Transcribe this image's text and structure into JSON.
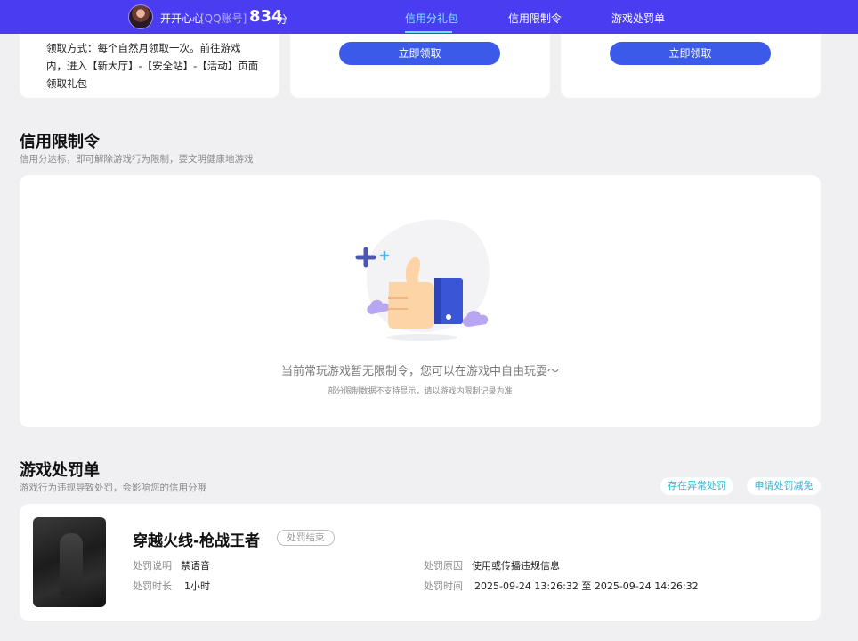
{
  "header": {
    "username": "开开心心",
    "account_type": "[QQ账号]",
    "score": "834",
    "score_unit": "分",
    "tabs": [
      {
        "label": "信用分礼包",
        "active": true
      },
      {
        "label": "信用限制令",
        "active": false
      },
      {
        "label": "游戏处罚单",
        "active": false
      }
    ]
  },
  "gift_section": {
    "claim_method": "领取方式：每个自然月领取一次。前往游戏内，进入【新大厅】-【安全站】-【活动】页面领取礼包",
    "claim_buttons": [
      "立即领取",
      "立即领取"
    ]
  },
  "restriction_section": {
    "title": "信用限制令",
    "subtitle": "信用分达标，即可解除游戏行为限制，要文明健康地游戏",
    "empty_message": "当前常玩游戏暂无限制令，您可以在游戏中自由玩耍～",
    "empty_note": "部分限制数据不支持显示，请以游戏内限制记录为准"
  },
  "penalty_section": {
    "title": "游戏处罚单",
    "subtitle": "游戏行为违规导致处罚，会影响您的信用分哦",
    "actions": [
      "存在异常处罚",
      "申请处罚减免"
    ],
    "record": {
      "game": "穿越火线-枪战王者",
      "status": "处罚结束",
      "labels": {
        "description": "处罚说明",
        "duration": "处罚时长",
        "reason": "处罚原因",
        "time": "处罚时间"
      },
      "description": "禁语音",
      "duration": "1小时",
      "reason": "使用或传播违规信息",
      "time": "2025-09-24 13:26:32 至 2025-09-24 14:26:32"
    }
  },
  "colors": {
    "header_bg": "#4a3cf0",
    "active_tab": "#7ee9ff",
    "button_blue": "#3c5ae8",
    "link_cyan": "#2fb6d9",
    "page_bg": "#f0f0f2"
  }
}
